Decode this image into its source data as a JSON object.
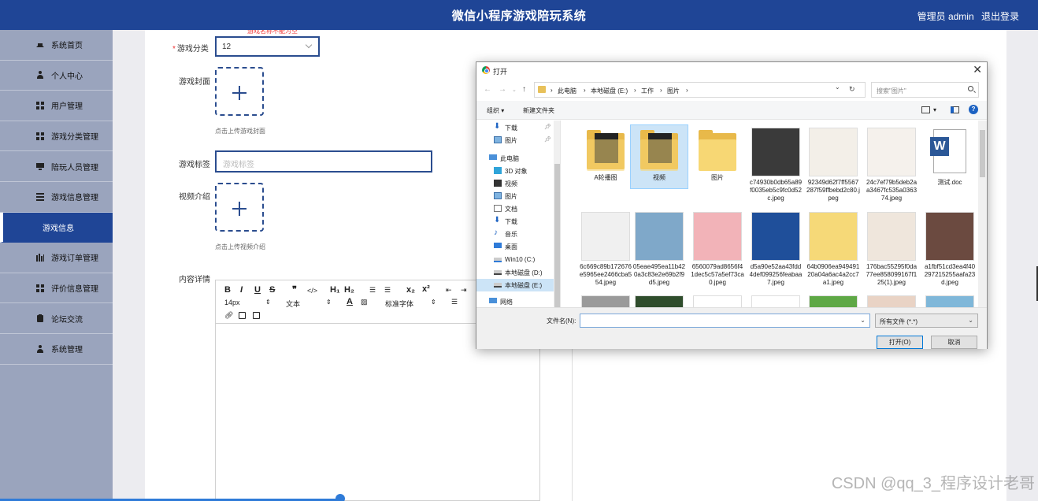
{
  "header": {
    "title": "微信小程序游戏陪玩系统",
    "user_label": "管理员 admin",
    "logout_label": "退出登录"
  },
  "sidebar": {
    "items": [
      {
        "label": "系统首页",
        "icon": "home-icon"
      },
      {
        "label": "个人中心",
        "icon": "user-icon"
      },
      {
        "label": "用户管理",
        "icon": "grid-icon"
      },
      {
        "label": "游戏分类管理",
        "icon": "grid-icon"
      },
      {
        "label": "陪玩人员管理",
        "icon": "monitor-icon"
      },
      {
        "label": "游戏信息管理",
        "icon": "list-icon"
      },
      {
        "label": "游戏信息",
        "icon": "",
        "active": true
      },
      {
        "label": "游戏订单管理",
        "icon": "chart-icon"
      },
      {
        "label": "评价信息管理",
        "icon": "grid-icon"
      },
      {
        "label": "论坛交流",
        "icon": "clipboard-icon"
      },
      {
        "label": "系统管理",
        "icon": "user-icon"
      }
    ]
  },
  "form": {
    "cut_error": "游戏名称不能为空",
    "category_label": "游戏分类",
    "category_value": "12",
    "cover_label": "游戏封面",
    "cover_hint": "点击上传游戏封面",
    "tags_label": "游戏标签",
    "tags_placeholder": "游戏标签",
    "video_label": "视频介绍",
    "video_hint": "点击上传视频介绍",
    "content_label": "内容详情"
  },
  "editor": {
    "font_size": "14px",
    "text_type": "文本",
    "font_family": "标准字体"
  },
  "dialog": {
    "title": "打开",
    "path": [
      "此电脑",
      "本地磁盘 (E:)",
      "工作",
      "图片"
    ],
    "search_placeholder": "搜索\"图片\"",
    "organize": "组织 ▾",
    "new_folder": "新建文件夹",
    "nav": [
      {
        "label": "下载",
        "pinned": true
      },
      {
        "label": "图片",
        "pinned": true
      },
      {
        "label": "此电脑"
      },
      {
        "label": "3D 对象"
      },
      {
        "label": "视频"
      },
      {
        "label": "图片"
      },
      {
        "label": "文档"
      },
      {
        "label": "下载"
      },
      {
        "label": "音乐"
      },
      {
        "label": "桌面"
      },
      {
        "label": "Win10 (C:)"
      },
      {
        "label": "本地磁盘 (D:)"
      },
      {
        "label": "本地磁盘 (E:)",
        "selected": true
      },
      {
        "label": "网络"
      }
    ],
    "files": [
      {
        "name": "A轮播图",
        "kind": "folder"
      },
      {
        "name": "视频",
        "kind": "folder",
        "selected": true
      },
      {
        "name": "图片",
        "kind": "folder-empty"
      },
      {
        "name": "c74930b0db65a89f0035eb5c9fc0d52c.jpeg",
        "kind": "image",
        "color": "#3a3a3a"
      },
      {
        "name": "92349d62f7ff5567287f59ffbebd2c80.jpeg",
        "kind": "image",
        "color": "#f3efe8"
      },
      {
        "name": "24c7ef79b5deb2aa3467fc535a036374.jpeg",
        "kind": "image",
        "color": "#f5f1ec"
      },
      {
        "name": "测试.doc",
        "kind": "doc"
      },
      {
        "name": "6c669c89b172676e5965ee2466cba554.jpeg",
        "kind": "image",
        "color": "#f0f0f0"
      },
      {
        "name": "05eae495ea11b420a3c83e2e69b2f9d5.jpeg",
        "kind": "image",
        "color": "#7fa8c9"
      },
      {
        "name": "6560079ad8656f41dec5c57a5ef73ca0.jpeg",
        "kind": "image",
        "color": "#f2b3b8"
      },
      {
        "name": "d5a90e52aa43fdd4def099256feabaa7.jpeg",
        "kind": "image",
        "color": "#1f4f9a"
      },
      {
        "name": "64b0906ea94949120a04a6ac4a2cc7a1.jpeg",
        "kind": "image",
        "color": "#f6d978"
      },
      {
        "name": "176bac55295f0da77ee858099167f125(1).jpeg",
        "kind": "image",
        "color": "#efe6dc"
      },
      {
        "name": "a1fbf51cd3ea4f40297215255aafa23d.jpeg",
        "kind": "image",
        "color": "#6b4a40"
      },
      {
        "name": "",
        "kind": "image",
        "color": "#9a9a9a"
      },
      {
        "name": "",
        "kind": "image",
        "color": "#2f4d2c"
      },
      {
        "name": "",
        "kind": "image",
        "color": "#ffffff"
      },
      {
        "name": "",
        "kind": "image",
        "color": "#ffffff"
      },
      {
        "name": "",
        "kind": "image",
        "color": "#5ea845"
      },
      {
        "name": "",
        "kind": "image",
        "color": "#e9d3c5"
      },
      {
        "name": "",
        "kind": "image",
        "color": "#7fb7d9"
      }
    ],
    "filename_label": "文件名(N):",
    "filename_value": "",
    "filetype": "所有文件 (*.*)",
    "open_label": "打开(O)",
    "cancel_label": "取消"
  },
  "watermark": "CSDN @qq_3_程序设计老哥",
  "colors": {
    "header_bg": "#1f4596",
    "sidebar_bg": "#9aa4bd",
    "accent": "#2b4d8f"
  }
}
